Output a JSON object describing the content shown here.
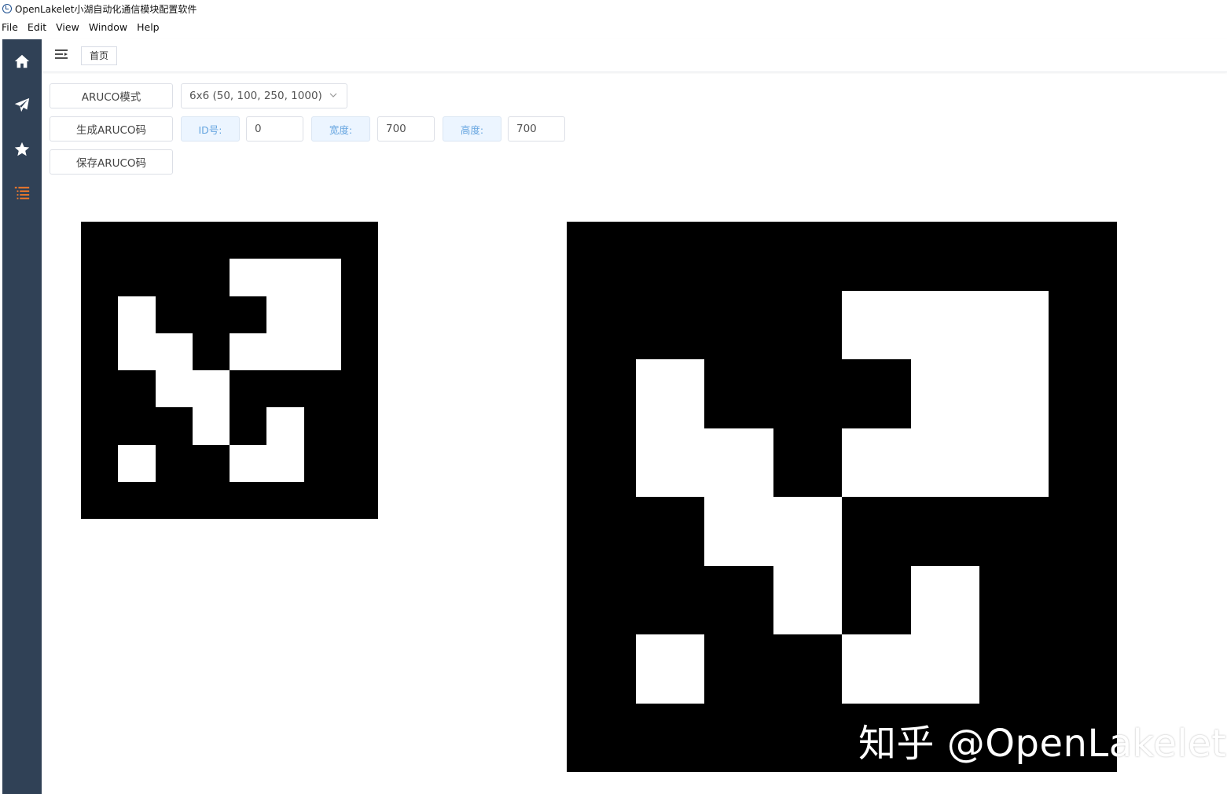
{
  "window": {
    "title": "OpenLakelet小湖自动化通信模块配置软件"
  },
  "menu": [
    "File",
    "Edit",
    "View",
    "Window",
    "Help"
  ],
  "sidebar": {
    "items": [
      {
        "icon": "home-icon",
        "color": "#ffffff"
      },
      {
        "icon": "paper-plane-icon",
        "color": "#ffffff"
      },
      {
        "icon": "star-icon",
        "color": "#ffffff"
      },
      {
        "icon": "list-icon",
        "color": "#f0782a",
        "active": true
      }
    ],
    "background": "#304156"
  },
  "header": {
    "tab_label": "首页"
  },
  "controls": {
    "mode_button": "ARUCO模式",
    "dictionary_select": "6x6 (50, 100, 250, 1000)",
    "generate_button": "生成ARUCO码",
    "save_button": "保存ARUCO码",
    "id_label": "ID号:",
    "id_value": "0",
    "width_label": "宽度:",
    "width_value": "700",
    "height_label": "高度:",
    "height_value": "700"
  },
  "marker": {
    "rows": [
      [
        0,
        0,
        0,
        0,
        0,
        0,
        0,
        0
      ],
      [
        0,
        0,
        0,
        0,
        1,
        1,
        1,
        0
      ],
      [
        0,
        1,
        0,
        0,
        0,
        1,
        1,
        0
      ],
      [
        0,
        1,
        1,
        0,
        1,
        1,
        1,
        0
      ],
      [
        0,
        0,
        1,
        1,
        0,
        0,
        0,
        0
      ],
      [
        0,
        0,
        0,
        1,
        0,
        1,
        0,
        0
      ],
      [
        0,
        1,
        0,
        0,
        1,
        1,
        0,
        0
      ],
      [
        0,
        0,
        0,
        0,
        0,
        0,
        0,
        0
      ]
    ]
  },
  "watermark": "知乎 @OpenLakelet"
}
